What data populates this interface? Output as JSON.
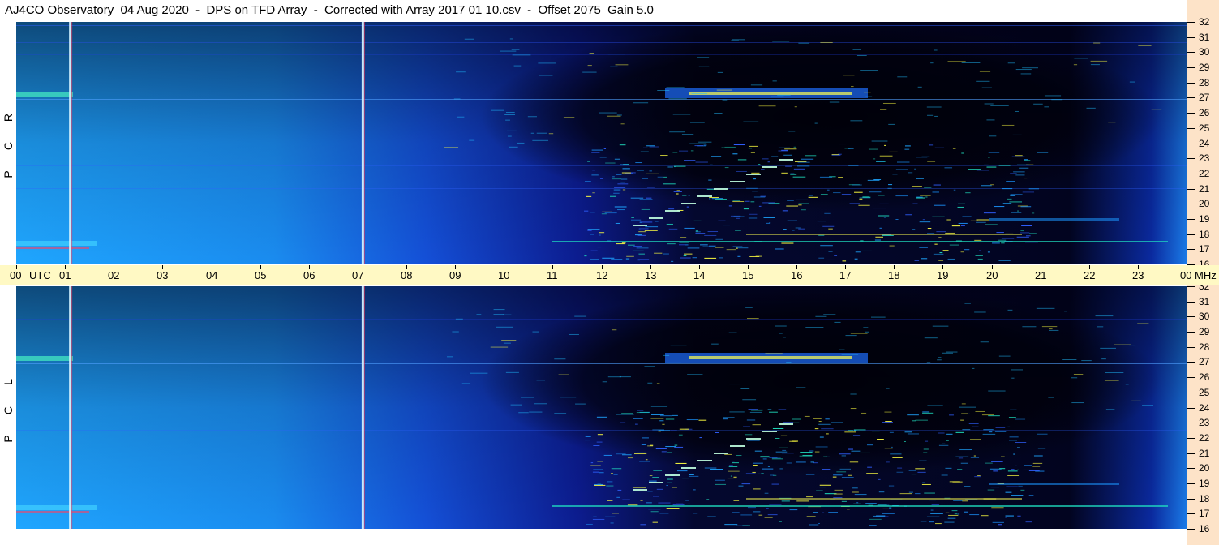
{
  "title": "AJ4CO Observatory  04 Aug 2020  -  DPS on TFD Array  -  Corrected with Array 2017 01 10.csv  -  Offset 2075  Gain 5.0",
  "panels": [
    {
      "id": "rcp",
      "letters": [
        "R",
        "C",
        "P"
      ]
    },
    {
      "id": "lcp",
      "letters": [
        "L",
        "C",
        "P"
      ]
    }
  ],
  "time_axis": {
    "labels": [
      "00",
      "01",
      "02",
      "03",
      "04",
      "05",
      "06",
      "07",
      "08",
      "09",
      "10",
      "11",
      "12",
      "13",
      "14",
      "15",
      "16",
      "17",
      "18",
      "19",
      "20",
      "21",
      "22",
      "23",
      "00"
    ],
    "utc_label": "UTC",
    "mhz_label": "MHz"
  },
  "freq_axis": {
    "labels": [
      "32",
      "31",
      "30",
      "29",
      "28",
      "27",
      "26",
      "25",
      "24",
      "23",
      "22",
      "21",
      "20",
      "19",
      "18",
      "17",
      "16"
    ]
  },
  "colors": {
    "background_blue": "#1030c8",
    "quiet_black": "#000008",
    "daytime_cyan": "#1fa6ff",
    "time_axis_bg": "#fff9c4",
    "freq_axis_bg": "#fde3c8",
    "marker_line": "#d0f0ff"
  },
  "chart_data": {
    "type": "heatmap",
    "subtype": "dynamic spectrogram",
    "x_axis": {
      "unit": "UTC hour",
      "range": [
        0,
        24
      ]
    },
    "y_axis": {
      "unit": "MHz",
      "range": [
        16,
        32
      ]
    },
    "panels": [
      "RCP",
      "LCP"
    ],
    "colorscale": [
      "#000008",
      "#1030c8",
      "#1fa6ff",
      "#20e0c0",
      "#ffff40"
    ],
    "features": {
      "daytime_enhancement_utc": [
        0,
        7
      ],
      "quiet_night_utc": [
        8,
        23
      ],
      "interference_band_mhz": [
        27
      ],
      "marker_lines_utc": [
        1.1,
        7.1
      ]
    }
  }
}
